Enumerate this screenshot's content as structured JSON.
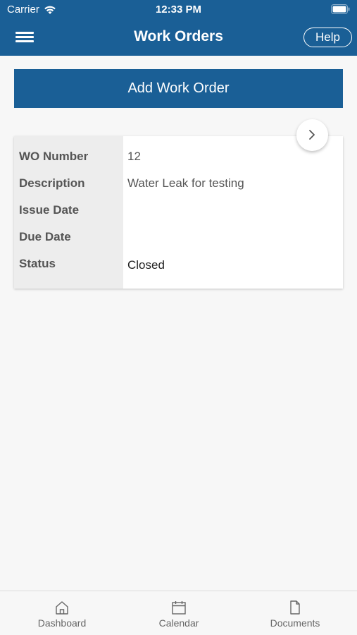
{
  "status_bar": {
    "carrier": "Carrier",
    "time": "12:33 PM"
  },
  "nav": {
    "title": "Work Orders",
    "help_label": "Help",
    "menu_icon": "hamburger-menu-icon"
  },
  "actions": {
    "add_label": "Add Work Order"
  },
  "work_order": {
    "rows": [
      {
        "label": "WO Number",
        "value": "12"
      },
      {
        "label": "Description",
        "value": "Water Leak for testing"
      },
      {
        "label": "Issue Date",
        "value": ""
      },
      {
        "label": "Due Date",
        "value": ""
      },
      {
        "label": "Status",
        "value": "Closed"
      }
    ],
    "open_icon": "chevron-right-icon"
  },
  "tabs": [
    {
      "label": "Dashboard",
      "icon": "home-icon"
    },
    {
      "label": "Calendar",
      "icon": "calendar-icon"
    },
    {
      "label": "Documents",
      "icon": "document-icon"
    }
  ],
  "colors": {
    "brand": "#1a5f96",
    "background": "#f7f7f7",
    "label_column": "#ededed"
  }
}
